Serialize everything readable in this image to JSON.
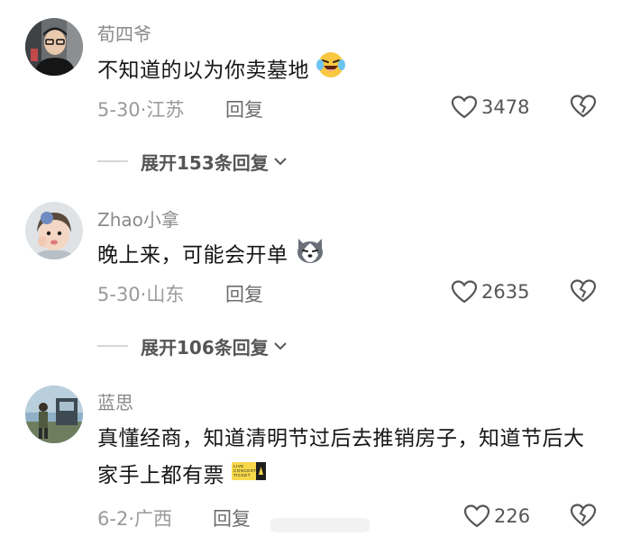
{
  "comments": [
    {
      "username": "荀四爷",
      "text": "不知道的以为你卖墓地",
      "emoji": "laughing-crying-emoji",
      "date": "5-30",
      "location": "江苏",
      "reply_label": "回复",
      "likes": "3478",
      "expand_label": "展开153条回复"
    },
    {
      "username": "Zhao小拿",
      "text": "晚上来，可能会开单",
      "emoji": "husky-dog-emoji",
      "date": "5-30",
      "location": "山东",
      "reply_label": "回复",
      "likes": "2635",
      "expand_label": "展开106条回复"
    },
    {
      "username": "蓝思",
      "text": "真懂经商，知道清明节过后去推销房子，知道节后大家手上都有票",
      "emoji": "concert-ticket-emoji",
      "ticket_line1": "LIVE",
      "ticket_line2": "CONCERT",
      "ticket_line3": "TICKET",
      "date": "6-2",
      "location": "广西",
      "reply_label": "回复",
      "likes": "226"
    }
  ],
  "date_separator": "·",
  "colors": {
    "text": "#161616",
    "meta": "#9a9a9a",
    "username": "#8a8a8a"
  }
}
